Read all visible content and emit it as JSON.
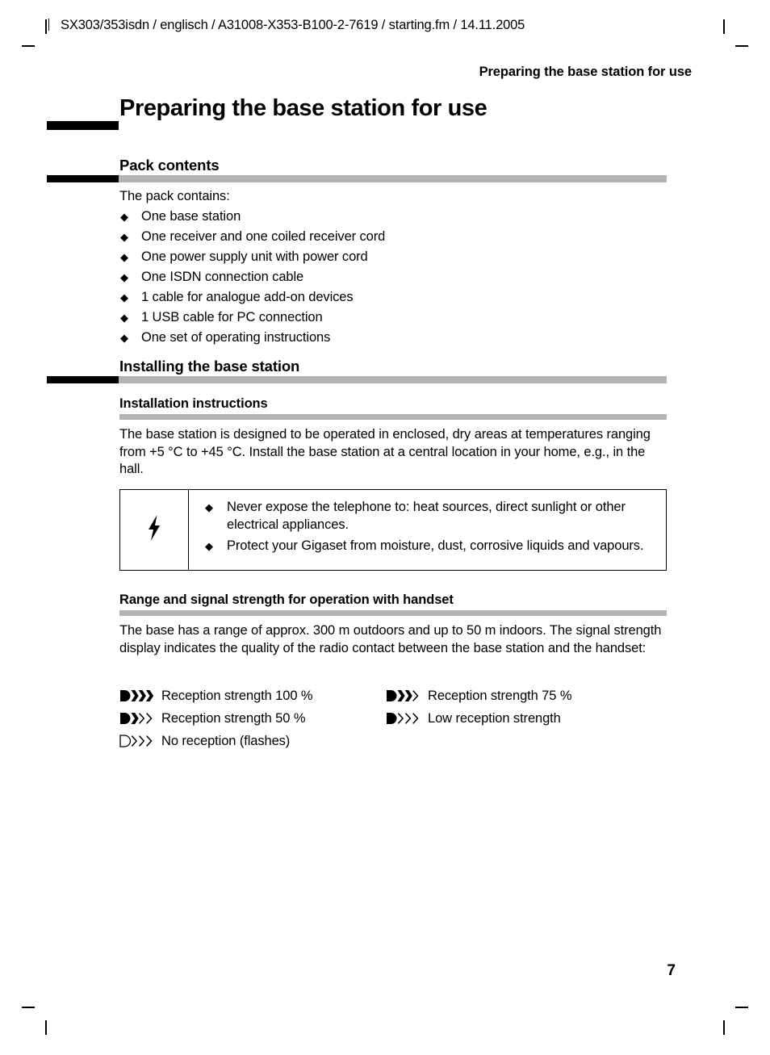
{
  "document": {
    "file_line": "SX303/353isdn / englisch / A31008-X353-B100-2-7619 / starting.fm / 14.11.2005",
    "running_head": "Preparing the base station for use",
    "page_number": "7",
    "accent_rule_color": "#b3b3b3",
    "marker_color": "#000000"
  },
  "chapter": {
    "title": "Preparing the base station for use"
  },
  "pack_contents": {
    "heading": "Pack contents",
    "intro": "The pack contains:",
    "bullet_glyph": "◆",
    "items": [
      "One base station",
      "One receiver and one coiled receiver cord",
      "One power supply unit with power cord",
      "One ISDN connection cable",
      "1 cable for analogue add-on devices",
      "1 USB cable for PC connection",
      "One set of operating instructions"
    ]
  },
  "installing": {
    "heading": "Installing the base station",
    "instructions": {
      "heading": "Installation instructions",
      "body": "The base station is designed to be operated in enclosed, dry areas at temperatures ranging from +5 °C to +45 °C. Install the base station at a central location in your home, e.g., in the hall."
    },
    "warning": {
      "icon": "lightning-bolt-icon",
      "icon_glyph": "⚡",
      "bullet_glyph": "◆",
      "items": [
        "Never expose the telephone to: heat sources, direct sunlight or other electrical appliances.",
        "Protect your Gigaset from moisture, dust, corrosive liquids and vapours."
      ]
    }
  },
  "range": {
    "heading": "Range and signal strength for operation with handset",
    "body": "The base has a range of approx. 300 m outdoors and up to 50 m indoors. The signal strength display indicates the quality of the radio contact between the base station and the handset:",
    "legend": [
      {
        "icon": "signal-strength-100-icon",
        "filled_chevrons": 3,
        "outline_chevrons": 0,
        "base_filled": true,
        "label": "Reception strength 100 %"
      },
      {
        "icon": "signal-strength-75-icon",
        "filled_chevrons": 2,
        "outline_chevrons": 1,
        "base_filled": true,
        "label": "Reception strength 75 %"
      },
      {
        "icon": "signal-strength-50-icon",
        "filled_chevrons": 1,
        "outline_chevrons": 2,
        "base_filled": true,
        "label": "Reception strength 50 %"
      },
      {
        "icon": "signal-strength-low-icon",
        "filled_chevrons": 0,
        "outline_chevrons": 3,
        "base_filled": true,
        "label": "Low reception strength"
      },
      {
        "icon": "signal-strength-none-icon",
        "filled_chevrons": 0,
        "outline_chevrons": 3,
        "base_filled": false,
        "label": "No reception (flashes)"
      }
    ]
  }
}
